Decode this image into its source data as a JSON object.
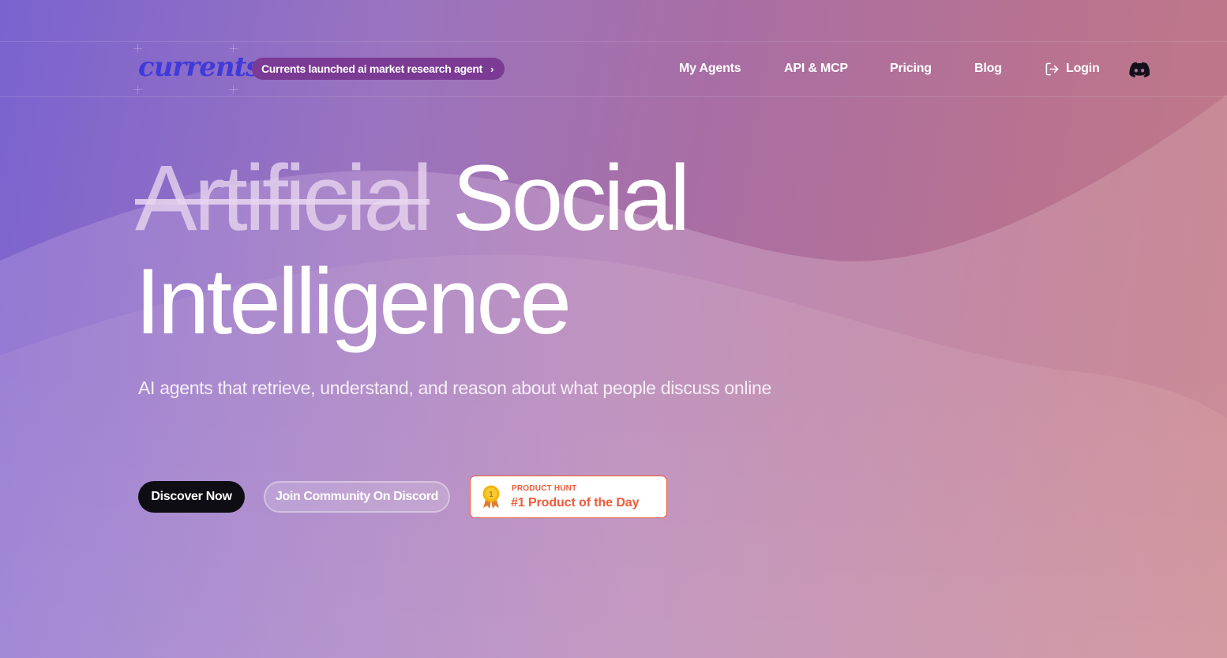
{
  "colors": {
    "logo": "#3f3ad9",
    "announce_bg": "#7b3a94",
    "primary_button_bg": "#0f0d14",
    "product_hunt_accent": "#ef5b3a"
  },
  "header": {
    "logo_text": "currents",
    "announcement": {
      "text": "Currents launched ai market research agent",
      "chevron": "›"
    },
    "nav": [
      {
        "label": "My Agents"
      },
      {
        "label": "API & MCP"
      },
      {
        "label": "Pricing"
      },
      {
        "label": "Blog"
      },
      {
        "label": "Login",
        "icon": "login-icon"
      }
    ],
    "discord_icon": "discord-icon"
  },
  "hero": {
    "title_struck": "Artificial",
    "title_word_2": "Social",
    "title_line_2": "Intelligence",
    "subtitle": "AI agents that retrieve, understand, and reason about what people discuss online",
    "primary_cta": "Discover Now",
    "secondary_cta": "Join Community On Discord",
    "product_hunt": {
      "kicker": "PRODUCT HUNT",
      "title": "#1 Product of the Day",
      "medal_number": "1",
      "icon": "medal-icon"
    }
  }
}
